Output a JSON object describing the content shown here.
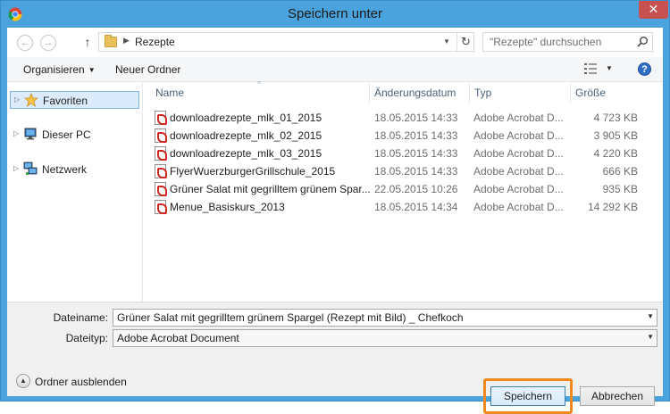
{
  "window": {
    "title": "Speichern unter",
    "close_glyph": "✕",
    "app_icon": "chrome-icon"
  },
  "address": {
    "back_glyph": "←",
    "forward_glyph": "→",
    "up_glyph": "↑",
    "separator_glyph": "▶",
    "path": "Rezepte",
    "dropdown_glyph": "▼",
    "refresh_glyph": "↻",
    "search_placeholder": "\"Rezepte\" durchsuchen"
  },
  "toolbar": {
    "organize_label": "Organisieren",
    "organize_arrow": "▼",
    "new_folder_label": "Neuer Ordner",
    "view_dropdown": "▼",
    "help_glyph": "?"
  },
  "nav": {
    "items": [
      {
        "label": "Favoriten",
        "icon": "star-icon",
        "selected": true
      },
      {
        "label": "Dieser PC",
        "icon": "computer-icon",
        "selected": false
      },
      {
        "label": "Netzwerk",
        "icon": "network-icon",
        "selected": false
      }
    ],
    "expand_glyph": "▷"
  },
  "columns": {
    "name": "Name",
    "date": "Änderungsdatum",
    "type": "Typ",
    "size": "Größe",
    "sort_glyph": "^"
  },
  "files": [
    {
      "name": "downloadrezepte_mlk_01_2015",
      "date": "18.05.2015 14:33",
      "type": "Adobe Acrobat D...",
      "size": "4 723 KB"
    },
    {
      "name": "downloadrezepte_mlk_02_2015",
      "date": "18.05.2015 14:33",
      "type": "Adobe Acrobat D...",
      "size": "3 905 KB"
    },
    {
      "name": "downloadrezepte_mlk_03_2015",
      "date": "18.05.2015 14:33",
      "type": "Adobe Acrobat D...",
      "size": "4 220 KB"
    },
    {
      "name": "FlyerWuerzburgerGrillschule_2015",
      "date": "18.05.2015 14:33",
      "type": "Adobe Acrobat D...",
      "size": "666 KB"
    },
    {
      "name": "Grüner Salat mit gegrilltem grünem Spar...",
      "date": "22.05.2015 10:26",
      "type": "Adobe Acrobat D...",
      "size": "935 KB"
    },
    {
      "name": "Menue_Basiskurs_2013",
      "date": "18.05.2015 14:34",
      "type": "Adobe Acrobat D...",
      "size": "14 292 KB"
    }
  ],
  "form": {
    "filename_label": "Dateiname:",
    "filename_value": "Grüner Salat mit gegrilltem grünem Spargel (Rezept mit Bild) _ Chefkoch",
    "filetype_label": "Dateityp:",
    "filetype_value": "Adobe Acrobat Document",
    "dropdown_glyph": "▼"
  },
  "footer": {
    "hide_folders_label": "Ordner ausblenden",
    "hide_glyph": "▲",
    "save_label": "Speichern",
    "cancel_label": "Abbrechen"
  },
  "colors": {
    "titlebar": "#4aa3dd",
    "close": "#c75050",
    "highlight": "#f08a1e",
    "selection": "#dcebfc"
  }
}
